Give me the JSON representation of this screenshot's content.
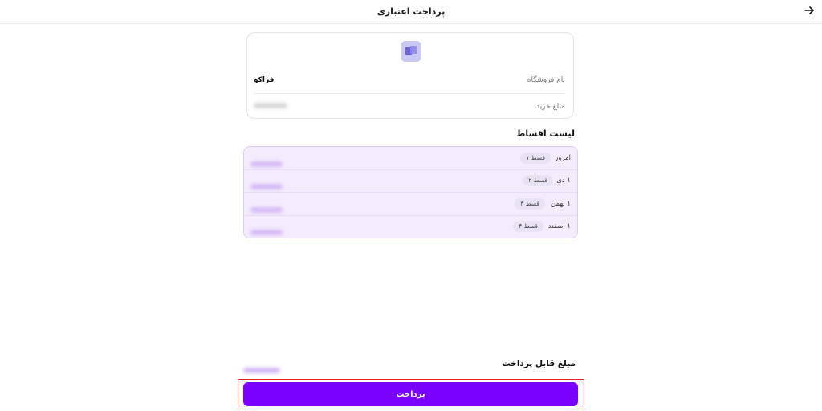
{
  "header": {
    "title": "پرداخت اعتباری",
    "back_icon": "arrow-right-icon"
  },
  "store": {
    "logo_icon": "store-logo-icon",
    "name_label": "نام فروشگاه",
    "name_value": "فراکو",
    "amount_label": "مبلغ خرید"
  },
  "installments": {
    "title": "لیست اقساط",
    "items": [
      {
        "date": "امروز",
        "label": "قسط ۱"
      },
      {
        "date": "۱ دی",
        "label": "قسط ۲"
      },
      {
        "date": "۱ بهمن",
        "label": "قسط ۳"
      },
      {
        "date": "۱ اسفند",
        "label": "قسط ۴"
      }
    ]
  },
  "payment": {
    "amount_label": "مبلغ قابل پرداخت",
    "button_label": "پرداخت"
  },
  "colors": {
    "accent": "#7a00ff",
    "installments_bg": "#f4ecfc",
    "highlight": "#e02424"
  }
}
